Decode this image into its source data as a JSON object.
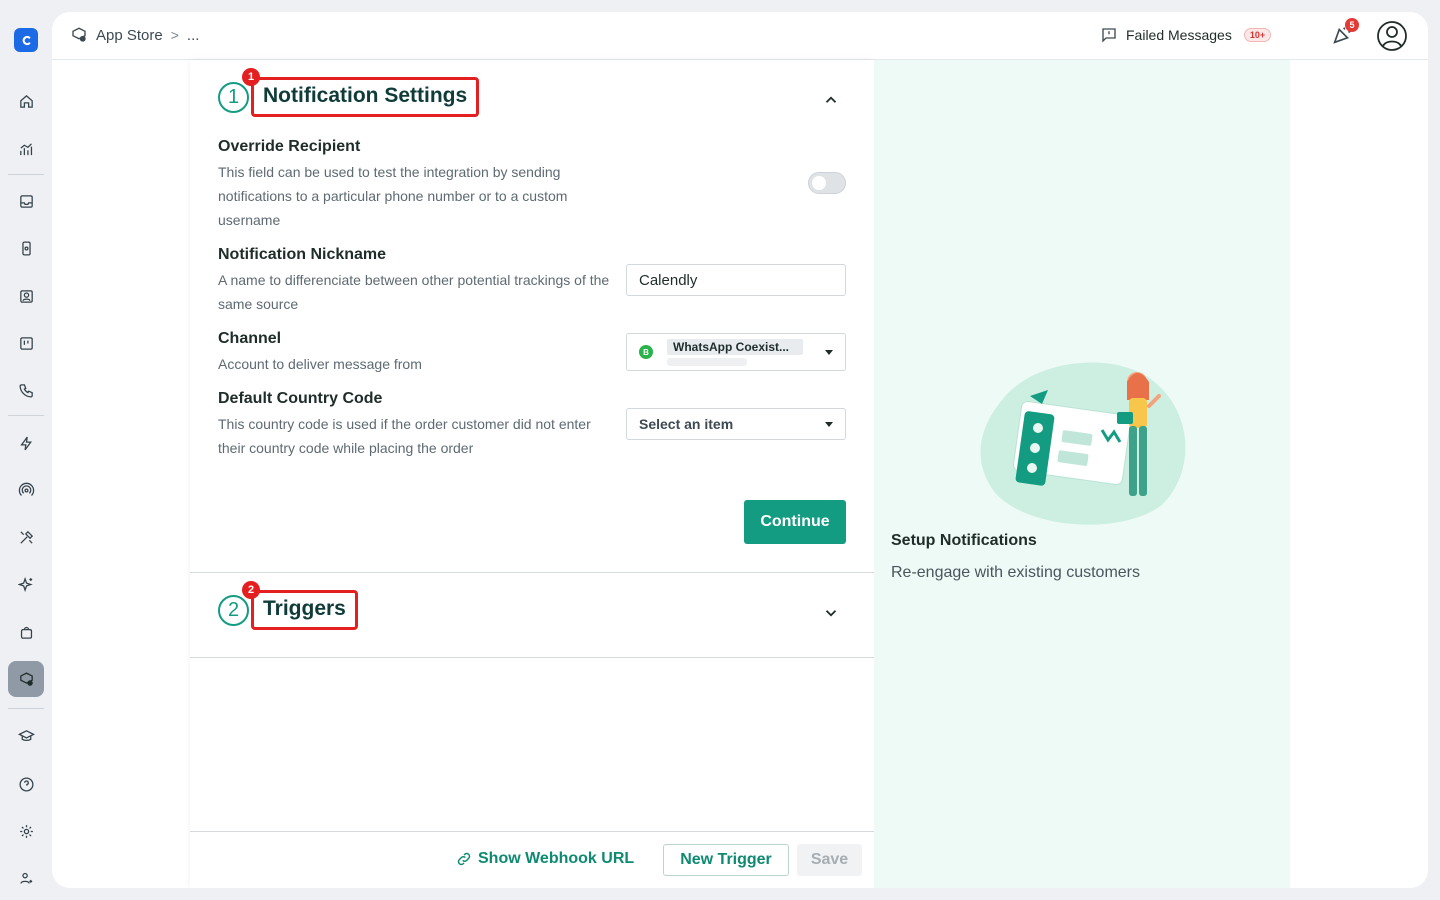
{
  "breadcrumb": {
    "root": "App Store",
    "separator": ">",
    "rest": "..."
  },
  "header": {
    "failed_messages_label": "Failed Messages",
    "failed_messages_count": "10+",
    "notification_count": "5"
  },
  "steps": [
    {
      "number": "1",
      "badge": "1",
      "title": "Notification Settings",
      "expanded": true
    },
    {
      "number": "2",
      "badge": "2",
      "title": "Triggers",
      "expanded": false
    }
  ],
  "fields": {
    "override": {
      "label": "Override Recipient",
      "description": "This field can be used to test the integration by sending notifications to a particular phone number or to a custom username",
      "enabled": false
    },
    "nickname": {
      "label": "Notification Nickname",
      "description": "A name to differenciate between other potential trackings of the same source",
      "value": "Calendly"
    },
    "channel": {
      "label": "Channel",
      "description": "Account to deliver message from",
      "value": "WhatsApp Coexist..."
    },
    "country": {
      "label": "Default Country Code",
      "description": "This country code is used if the order customer did not enter their country code while placing the order",
      "placeholder": "Select an item"
    }
  },
  "buttons": {
    "continue": "Continue",
    "show_webhook": "Show Webhook URL",
    "new_trigger": "New Trigger",
    "save": "Save"
  },
  "side": {
    "title": "Setup Notifications",
    "subtitle": "Re-engage with existing customers"
  },
  "colors": {
    "accent": "#149c83",
    "highlight": "#e3201f",
    "side_bg": "#eefaf5"
  }
}
